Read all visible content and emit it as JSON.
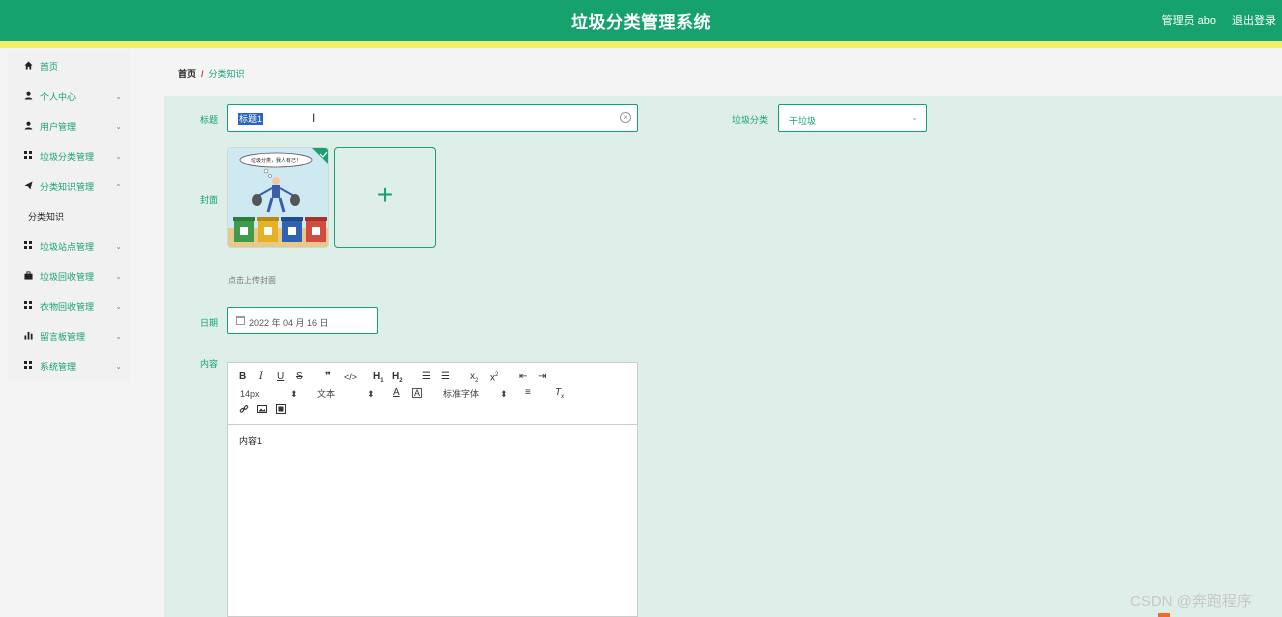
{
  "app": {
    "title": "垃圾分类管理系统",
    "user_label": "管理员 abo",
    "logout_label": "退出登录"
  },
  "sidebar": {
    "items": [
      {
        "label": "首页",
        "icon": "home-icon",
        "expandable": false
      },
      {
        "label": "个人中心",
        "icon": "user-icon",
        "expandable": true
      },
      {
        "label": "用户管理",
        "icon": "user-icon",
        "expandable": true
      },
      {
        "label": "垃圾分类管理",
        "icon": "grid-icon",
        "expandable": true
      },
      {
        "label": "分类知识管理",
        "icon": "send-icon",
        "expandable": true
      },
      {
        "label": "分类知识",
        "icon": "",
        "expandable": false
      },
      {
        "label": "垃圾站点管理",
        "icon": "grid-icon",
        "expandable": true
      },
      {
        "label": "垃圾回收管理",
        "icon": "briefcase-icon",
        "expandable": true
      },
      {
        "label": "衣物回收管理",
        "icon": "grid-icon",
        "expandable": true
      },
      {
        "label": "留言板管理",
        "icon": "bar-chart-icon",
        "expandable": true
      },
      {
        "label": "系统管理",
        "icon": "grid-icon",
        "expandable": true
      }
    ],
    "arrow": "⌄"
  },
  "breadcrumb": {
    "home": "首页",
    "separator": "/",
    "current": "分类知识"
  },
  "form": {
    "title_label": "标题",
    "title_value": "标题1",
    "category_label": "垃圾分类",
    "category_value": "干垃圾",
    "cover_label": "封面",
    "cover_image_caption": "垃圾分类，我人有己！",
    "upload_hint": "点击上传封面",
    "date_label": "日期",
    "date_value": "2022 年 04 月 16 日",
    "content_label": "内容",
    "content_value": "内容1"
  },
  "editor": {
    "font_size": "14px",
    "text_style": "文本",
    "font_family": "标准字体"
  },
  "watermark": "CSDN @奔跑程序",
  "colors": {
    "primary": "#15a26d",
    "accent_bar": "#f1ef6b",
    "content_bg": "#deeee8"
  }
}
